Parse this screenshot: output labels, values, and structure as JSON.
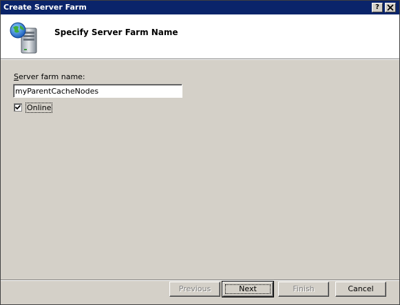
{
  "window": {
    "title": "Create Server Farm",
    "help_glyph": "?",
    "close_glyph": "✕"
  },
  "header": {
    "title": "Specify Server Farm Name",
    "icon": "server-globe-icon"
  },
  "form": {
    "name_label": "Server farm name:",
    "name_value": "myParentCacheNodes",
    "online_label": "Online",
    "online_checked": true
  },
  "buttons": {
    "previous": "Previous",
    "next": "Next",
    "finish": "Finish",
    "cancel": "Cancel"
  },
  "colors": {
    "titlebar": "#0a246a",
    "face": "#d4d0c8"
  }
}
